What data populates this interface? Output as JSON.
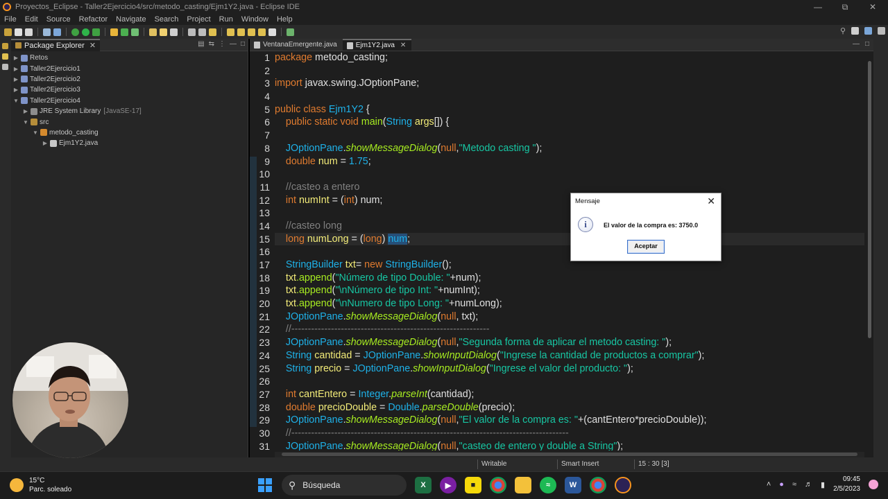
{
  "window": {
    "title": "Proyectos_Eclipse - Taller2Ejercicio4/src/metodo_casting/Ejm1Y2.java - Eclipse IDE"
  },
  "menu": [
    "File",
    "Edit",
    "Source",
    "Refactor",
    "Navigate",
    "Search",
    "Project",
    "Run",
    "Window",
    "Help"
  ],
  "explorer": {
    "tab_label": "Package Explorer",
    "items": [
      {
        "label": "Retos",
        "detail": ""
      },
      {
        "label": "Taller2Ejercicio1",
        "detail": ""
      },
      {
        "label": "Taller2Ejercicio2",
        "detail": ""
      },
      {
        "label": "Taller2Ejercicio3",
        "detail": ""
      },
      {
        "label": "Taller2Ejercicio4",
        "detail": ""
      },
      {
        "label": "JRE System Library",
        "detail": "[JavaSE-17]"
      },
      {
        "label": "src",
        "detail": ""
      },
      {
        "label": "metodo_casting",
        "detail": ""
      },
      {
        "label": "Ejm1Y2.java",
        "detail": ""
      }
    ]
  },
  "editor": {
    "tabs": [
      "VentanaEmergente.java",
      "Ejm1Y2.java"
    ],
    "active_tab": "Ejm1Y2.java",
    "line_numbers": [
      "1",
      "2",
      "3",
      "4",
      "5",
      "6",
      "7",
      "8",
      "9",
      "10",
      "11",
      "12",
      "13",
      "14",
      "15",
      "16",
      "17",
      "18",
      "19",
      "20",
      "21",
      "22",
      "23",
      "24",
      "25",
      "26",
      "27",
      "28",
      "29",
      "30",
      "31"
    ],
    "code": {
      "l1_kw": "package",
      "l1_rest": " metodo_casting;",
      "l3_kw": "import",
      "l3_rest": " javax.swing.JOptionPane;",
      "l5_kw": "public class",
      "l5_name": "Ejm1Y2",
      "l5_rest": " {",
      "l6_kw": "public static void",
      "l6_fn": "main",
      "l6_p1": "(",
      "l6_ty": "String",
      "l6_var": "args",
      "l6_rest": "[]) {",
      "l8_ty": "JOptionPane",
      "l8_fn": "showMessageDialog",
      "l8_p": "(",
      "l8_kw": "null",
      "l8_c": ",",
      "l8_st": "\"Metodo casting \"",
      "l8_e": ");",
      "l9_kw": "double",
      "l9_var": "num",
      "l9_eq": " = ",
      "l9_val": "1.75",
      "l9_e": ";",
      "l11_cm": "//casteo a entero",
      "l12_kw": "int",
      "l12_var": "numInt",
      "l12_eq": " = (",
      "l12_kw2": "int",
      "l12_e": ") num;",
      "l14_cm": "//casteo long",
      "l15_kw": "long",
      "l15_var": "numLong",
      "l15_eq": " = (",
      "l15_kw2": "long",
      "l15_p": ") ",
      "l15_sel": "num",
      "l15_e": ";",
      "l17_ty": "StringBuilder",
      "l17_var": "txt",
      "l17_eq": "= ",
      "l17_kw": "new",
      "l17_ty2": "StringBuilder",
      "l17_e": "();",
      "l18_v": "txt",
      "l18_fn": ".append",
      "l18_p": "(",
      "l18_st": "\"Número de tipo Double: \"",
      "l18_e": "+num);",
      "l19_v": "txt",
      "l19_fn": ".append",
      "l19_p": "(",
      "l19_st": "\"\\nNúmero de tipo Int: \"",
      "l19_e": "+numInt);",
      "l20_v": "txt",
      "l20_fn": ".append",
      "l20_p": "(",
      "l20_st": "\"\\nNumero de tipo Long: \"",
      "l20_e": "+numLong);",
      "l21_ty": "JOptionPane",
      "l21_fn": "showMessageDialog",
      "l21_p": "(",
      "l21_kw": "null",
      "l21_e": ", txt);",
      "l22_cm": "//------------------------------------------------------------",
      "l23_ty": "JOptionPane",
      "l23_fn": "showMessageDialog",
      "l23_p": "(",
      "l23_kw": "null",
      "l23_c": ",",
      "l23_st": "\"Segunda forma de aplicar el metodo casting: \"",
      "l23_e": ");",
      "l24_ty": "String",
      "l24_var": "cantidad",
      "l24_eq": " = ",
      "l24_ty2": "JOptionPane",
      "l24_fn": "showInputDialog",
      "l24_p": "(",
      "l24_st": "\"Ingrese la cantidad de productos a comprar\"",
      "l24_e": ");",
      "l25_ty": "String",
      "l25_var": "precio",
      "l25_eq": " = ",
      "l25_ty2": "JOptionPane",
      "l25_fn": "showInputDialog",
      "l25_p": "(",
      "l25_st": "\"Ingrese el valor del producto: \"",
      "l25_e": ");",
      "l27_kw": "int",
      "l27_var": "cantEntero",
      "l27_eq": " = ",
      "l27_ty": "Integer",
      "l27_fn": "parseInt",
      "l27_e": "(cantidad);",
      "l28_kw": "double",
      "l28_var": "precioDouble",
      "l28_eq": " = ",
      "l28_ty": "Double",
      "l28_fn": "parseDouble",
      "l28_e": "(precio);",
      "l29_ty": "JOptionPane",
      "l29_fn": "showMessageDialog",
      "l29_p": "(",
      "l29_kw": "null",
      "l29_c": ",",
      "l29_st": "\"El valor de la compra es: \"",
      "l29_e": "+(cantEntero*precioDouble));",
      "l30_cm": "//------------------------------------------------------------------------------------",
      "l31_ty": "JOptionPane",
      "l31_fn": "showMessageDialog",
      "l31_p": "(",
      "l31_kw": "null",
      "l31_c": ",",
      "l31_st": "\"casteo de entero y double a String\"",
      "l31_e": ");"
    }
  },
  "status": {
    "writable": "Writable",
    "insert_mode": "Smart Insert",
    "position": "15 : 30 [3]"
  },
  "dialog": {
    "title": "Mensaje",
    "message": "El valor de la compra es: 3750.0",
    "ok_label": "Aceptar",
    "info_glyph": "i"
  },
  "taskbar": {
    "temperature": "15°C",
    "weather": "Parc. soleado",
    "search_label": "Búsqueda",
    "time": "09:45",
    "date": "2/5/2023"
  },
  "colors": {
    "keyword": "#e07b2f",
    "type": "#1eb1e8",
    "method": "#a7ec21",
    "variable": "#f3ec79",
    "string": "#17c6a3",
    "comment": "#808080"
  }
}
